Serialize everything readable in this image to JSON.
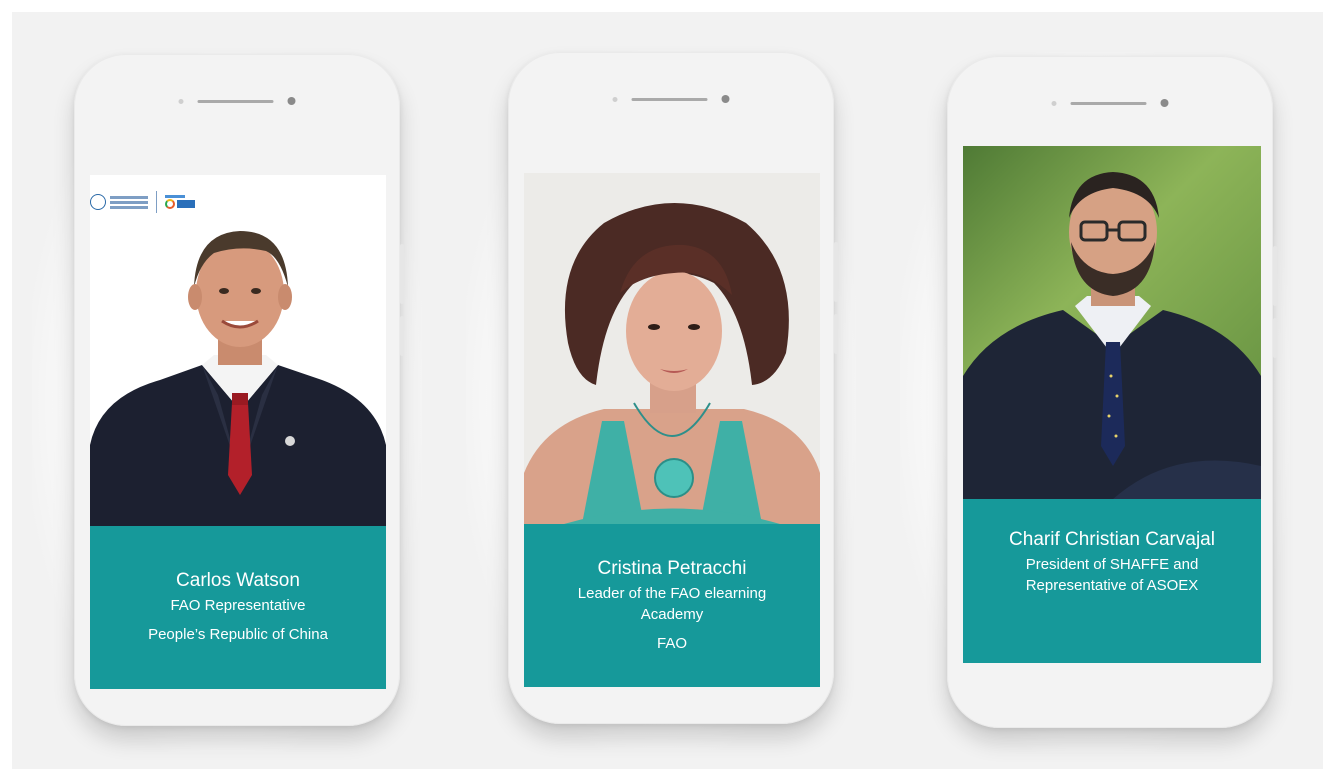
{
  "speakers": [
    {
      "name": "Carlos Watson",
      "lines": [
        "FAO Representative",
        "People’s Republic of China"
      ],
      "photo": "portrait-man-dark-suit-red-tie-white-background"
    },
    {
      "name": "Cristina Petracchi",
      "lines": [
        "Leader of the FAO elearning",
        "Academy",
        "FAO"
      ],
      "photo": "portrait-woman-curly-hair-teal-top-light-background"
    },
    {
      "name": "Charif Christian Carvajal",
      "lines": [
        "President of SHAFFE and",
        "Representative of ASOEX"
      ],
      "photo": "portrait-man-glasses-navy-suit-green-background"
    }
  ],
  "colors": {
    "background": "#f2f2f2",
    "phone": "#f3f3f3",
    "caption": "#16999a",
    "caption_text": "#ffffff"
  }
}
